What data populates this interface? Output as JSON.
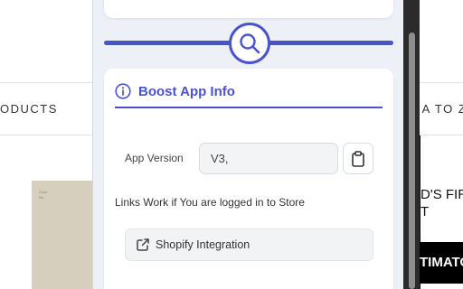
{
  "store": {
    "products_label": "ODUCTS",
    "sort_label": "E A TO Z",
    "product_image_text": "Color\nNo.",
    "banner_lines": [
      "D'S FIR",
      "T"
    ],
    "banner_black_text": "TIMATO"
  },
  "popup": {
    "accent_color": "#4a53c9",
    "slider": {
      "handle_icon": "search-icon"
    },
    "info": {
      "icon": "info-circle-icon",
      "title": "Boost App Info",
      "version_label": "App Version",
      "version_value": "V3,",
      "copy_icon": "clipboard-icon",
      "links_note": "Links Work if You are logged in to Store",
      "integration_icon": "external-link-icon",
      "integration_label": "Shopify Integration"
    }
  }
}
